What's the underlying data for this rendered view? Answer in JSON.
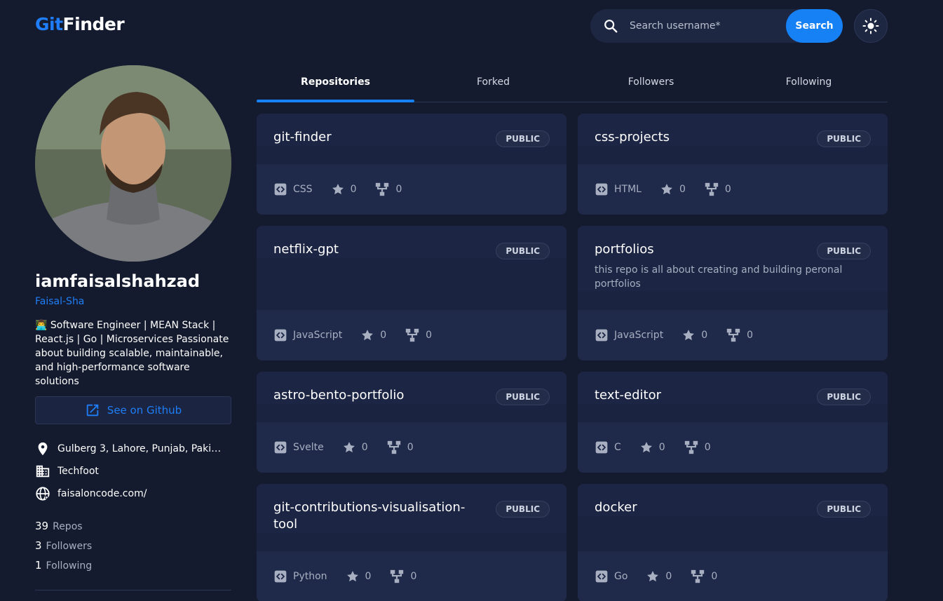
{
  "header": {
    "logo_part1": "Git",
    "logo_part2": "Finder",
    "search_placeholder": "Search username*",
    "search_button": "Search"
  },
  "profile": {
    "username": "iamfaisalshahzad",
    "login": "Faisal-Sha",
    "bio": "👨‍💻 Software Engineer | MEAN Stack | React.js | Go | Microservices Passionate about building scalable, maintainable, and high-performance software solutions",
    "github_button": "See on Github",
    "location": "Gulberg 3, Lahore, Punjab, Pakist…",
    "company": "Techfoot",
    "website": "faisaloncode.com/",
    "stats": [
      {
        "value": "39",
        "label": "Repos"
      },
      {
        "value": "3",
        "label": "Followers"
      },
      {
        "value": "1",
        "label": "Following"
      }
    ]
  },
  "tabs": [
    {
      "label": "Repositories",
      "active": true
    },
    {
      "label": "Forked",
      "active": false
    },
    {
      "label": "Followers",
      "active": false
    },
    {
      "label": "Following",
      "active": false
    }
  ],
  "repos": [
    {
      "name": "git-finder",
      "visibility": "PUBLIC",
      "description": "",
      "language": "CSS",
      "stars": "0",
      "forks": "0"
    },
    {
      "name": "css-projects",
      "visibility": "PUBLIC",
      "description": "",
      "language": "HTML",
      "stars": "0",
      "forks": "0"
    },
    {
      "name": "netflix-gpt",
      "visibility": "PUBLIC",
      "description": "",
      "language": "JavaScript",
      "stars": "0",
      "forks": "0"
    },
    {
      "name": "portfolios",
      "visibility": "PUBLIC",
      "description": "this repo is all about creating and building peronal portfolios",
      "language": "JavaScript",
      "stars": "0",
      "forks": "0"
    },
    {
      "name": "astro-bento-portfolio",
      "visibility": "PUBLIC",
      "description": "",
      "language": "Svelte",
      "stars": "0",
      "forks": "0"
    },
    {
      "name": "text-editor",
      "visibility": "PUBLIC",
      "description": "",
      "language": "C",
      "stars": "0",
      "forks": "0"
    },
    {
      "name": "git-contributions-visualisation-tool",
      "visibility": "PUBLIC",
      "description": "",
      "language": "Python",
      "stars": "0",
      "forks": "0"
    },
    {
      "name": "docker",
      "visibility": "PUBLIC",
      "description": "",
      "language": "Go",
      "stars": "0",
      "forks": "0"
    }
  ],
  "colors": {
    "accent": "#1681f5",
    "background": "#141b2e",
    "card": "#1c2543"
  }
}
